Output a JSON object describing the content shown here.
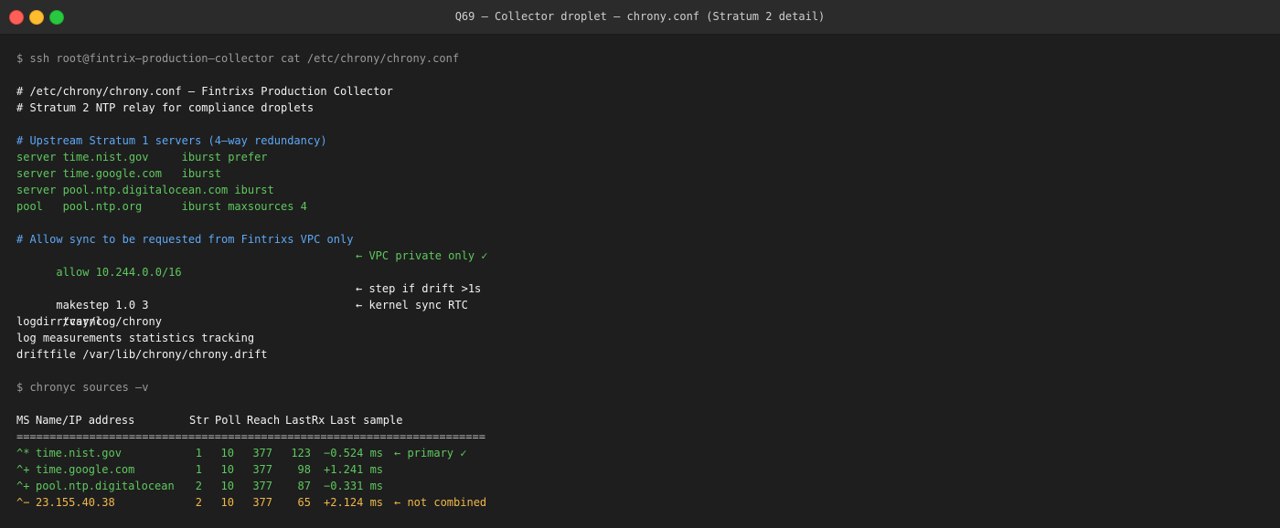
{
  "window": {
    "title": "Q69 — Collector droplet — chrony.conf (Stratum 2 detail)"
  },
  "terminal": {
    "cmd1": "$ ssh root@fintrix–production–collector cat /etc/chrony/chrony.conf",
    "header1": "# /etc/chrony/chrony.conf — Fintrixs Production Collector",
    "header2": "# Stratum 2 NTP relay for compliance droplets",
    "upstream_comment": "# Upstream Stratum 1 servers (4–way redundancy)",
    "servers": [
      "server time.nist.gov     iburst prefer",
      "server time.google.com   iburst",
      "server pool.ntp.digitalocean.com iburst",
      "pool   pool.ntp.org      iburst maxsources 4"
    ],
    "allow_comment": "# Allow sync to be requested from Fintrixs VPC only",
    "allow_line": "allow 10.244.0.0/16",
    "allow_note": "← VPC private only ✓",
    "makestep_line": "makestep 1.0 3",
    "makestep_note": "← step if drift >1s",
    "rtcsync_line": "rtcsync",
    "rtcsync_note": "← kernel sync RTC",
    "logdir_line": "logdir /var/log/chrony",
    "log_line": "log measurements statistics tracking",
    "driftfile_line": "driftfile /var/lib/chrony/chrony.drift",
    "cmd2": "$ chronyc sources –v",
    "table_header": {
      "ms": "MS",
      "name": "Name/IP address",
      "str": "Str",
      "poll": "Poll",
      "reach": "Reach",
      "lastrx": "LastRx",
      "sample": "Last sample"
    },
    "table_rule": "=======================================================================",
    "sources": [
      {
        "ms": "^*",
        "name": "time.nist.gov",
        "str": "1",
        "poll": "10",
        "reach": "377",
        "lastrx": "123",
        "sample": "−0.524 ms",
        "note": "← primary ✓",
        "color": "#5ec85e"
      },
      {
        "ms": "^+",
        "name": "time.google.com",
        "str": "1",
        "poll": "10",
        "reach": "377",
        "lastrx": "98",
        "sample": "+1.241 ms",
        "note": "",
        "color": "#5ec85e"
      },
      {
        "ms": "^+",
        "name": "pool.ntp.digitalocean",
        "str": "2",
        "poll": "10",
        "reach": "377",
        "lastrx": "87",
        "sample": "−0.331 ms",
        "note": "",
        "color": "#5ec85e"
      },
      {
        "ms": "^−",
        "name": "23.155.40.38",
        "str": "2",
        "poll": "10",
        "reach": "377",
        "lastrx": "65",
        "sample": "+2.124 ms",
        "note": "← not combined",
        "color": "#f0b84a"
      }
    ]
  }
}
